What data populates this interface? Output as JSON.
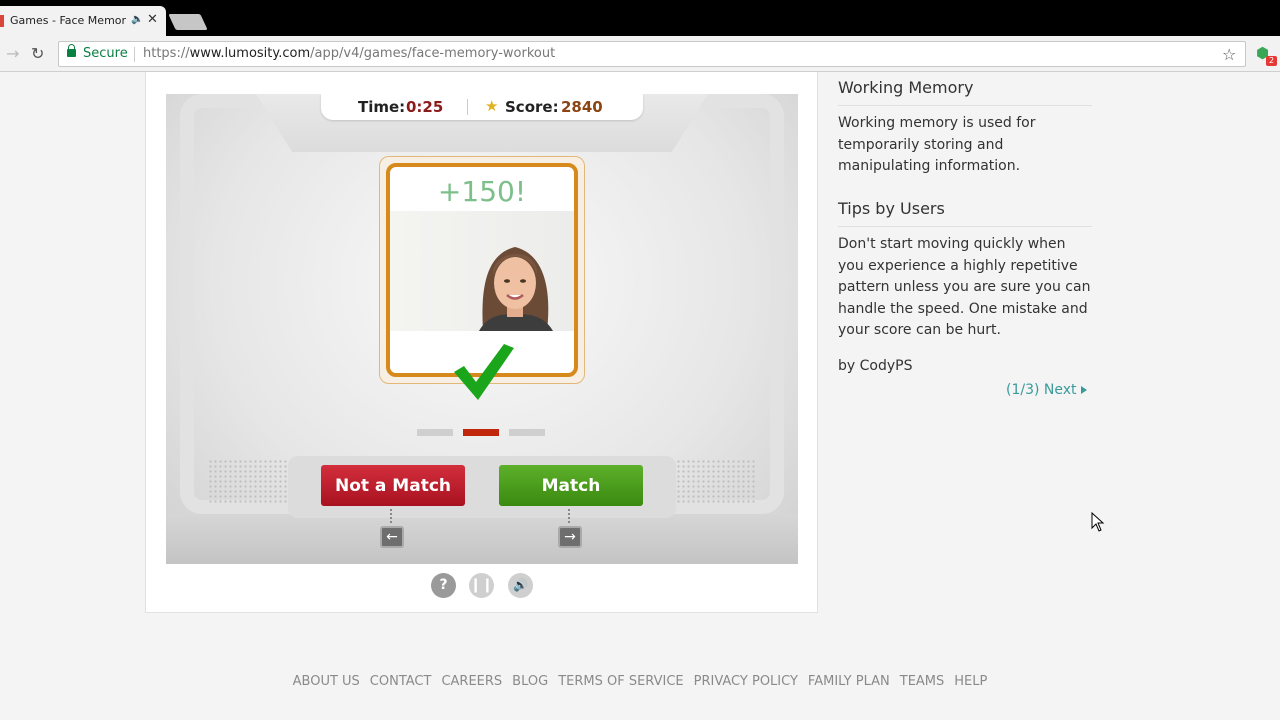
{
  "browser": {
    "tab_title": "Games - Face Memory Workout",
    "secure_label": "Secure",
    "url_prefix": "https://",
    "url_host": "www.lumosity.com",
    "url_path": "/app/v4/games/face-memory-workout",
    "extension_badge": "2"
  },
  "game": {
    "time_label": "Time:",
    "time_value": "0:25",
    "score_label": "Score:",
    "score_value": "2840",
    "points_popup": "+150!",
    "progress_active_index": 1,
    "progress_count": 3,
    "not_match_label": "Not a Match",
    "match_label": "Match",
    "left_key": "←",
    "right_key": "→",
    "colors": {
      "time": "#8b1a1a",
      "score": "#8b4513",
      "not_match": "#c0202e",
      "match": "#4a9e1c",
      "card_border": "#d68a1c",
      "check": "#1aa51a"
    }
  },
  "sidebar": {
    "heading1": "Working Memory",
    "text1": "Working memory is used for temporarily storing and manipulating information.",
    "heading2": "Tips by Users",
    "tip_text": "Don't start moving quickly when you experience a highly repetitive pattern unless you are sure you can handle the speed. One mistake and your score can be hurt.",
    "tip_author": "by CodyPS",
    "pager": "(1/3)",
    "next_label": "Next"
  },
  "footer": {
    "links": [
      "ABOUT US",
      "CONTACT",
      "CAREERS",
      "BLOG",
      "TERMS OF SERVICE",
      "PRIVACY POLICY",
      "FAMILY PLAN",
      "TEAMS",
      "HELP"
    ]
  }
}
